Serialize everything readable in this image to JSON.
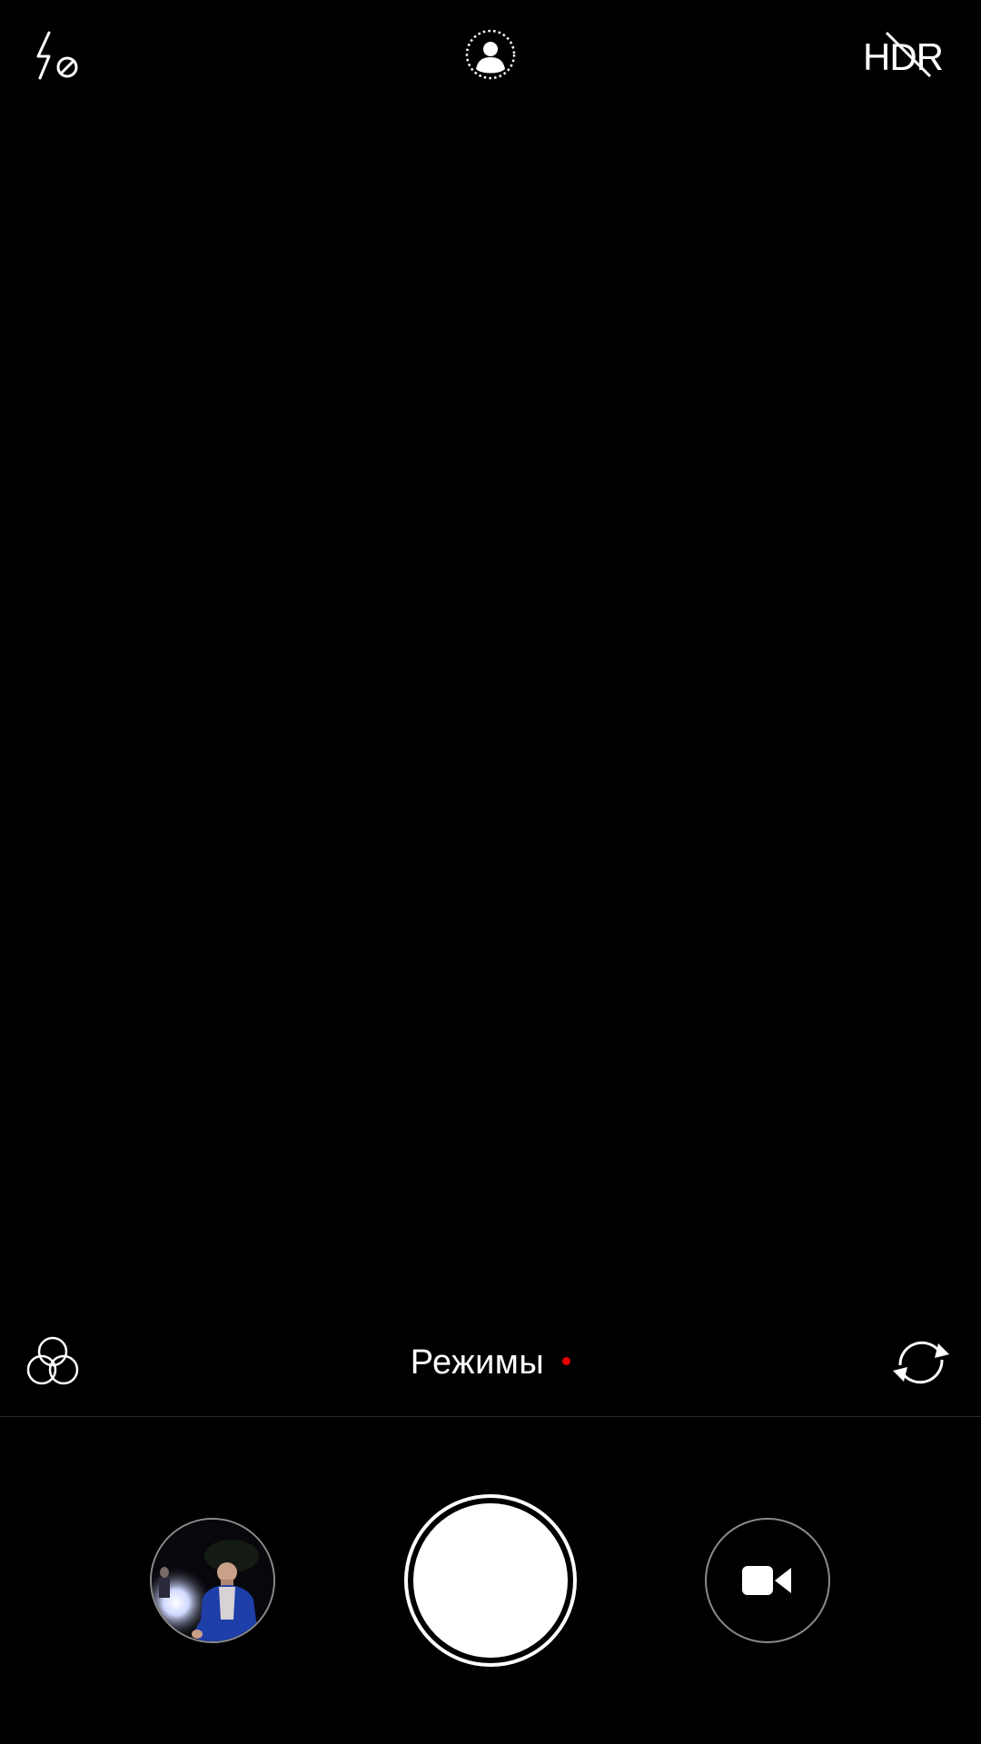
{
  "top_bar": {
    "flash_icon": "flash-off-icon",
    "beauty_icon": "portrait-beauty-icon",
    "hdr_label": "HDR",
    "hdr_state": "off"
  },
  "controls": {
    "filters_icon": "filters-icon",
    "modes_label": "Режимы",
    "modes_badge_color": "#e60000",
    "switch_icon": "camera-switch-icon"
  },
  "bottom_bar": {
    "gallery_icon": "gallery-thumbnail",
    "shutter_icon": "shutter-button",
    "video_icon": "video-camera-icon"
  },
  "colors": {
    "background": "#000000",
    "foreground": "#ffffff",
    "ring": "#8a8a8a",
    "accent": "#e60000"
  }
}
